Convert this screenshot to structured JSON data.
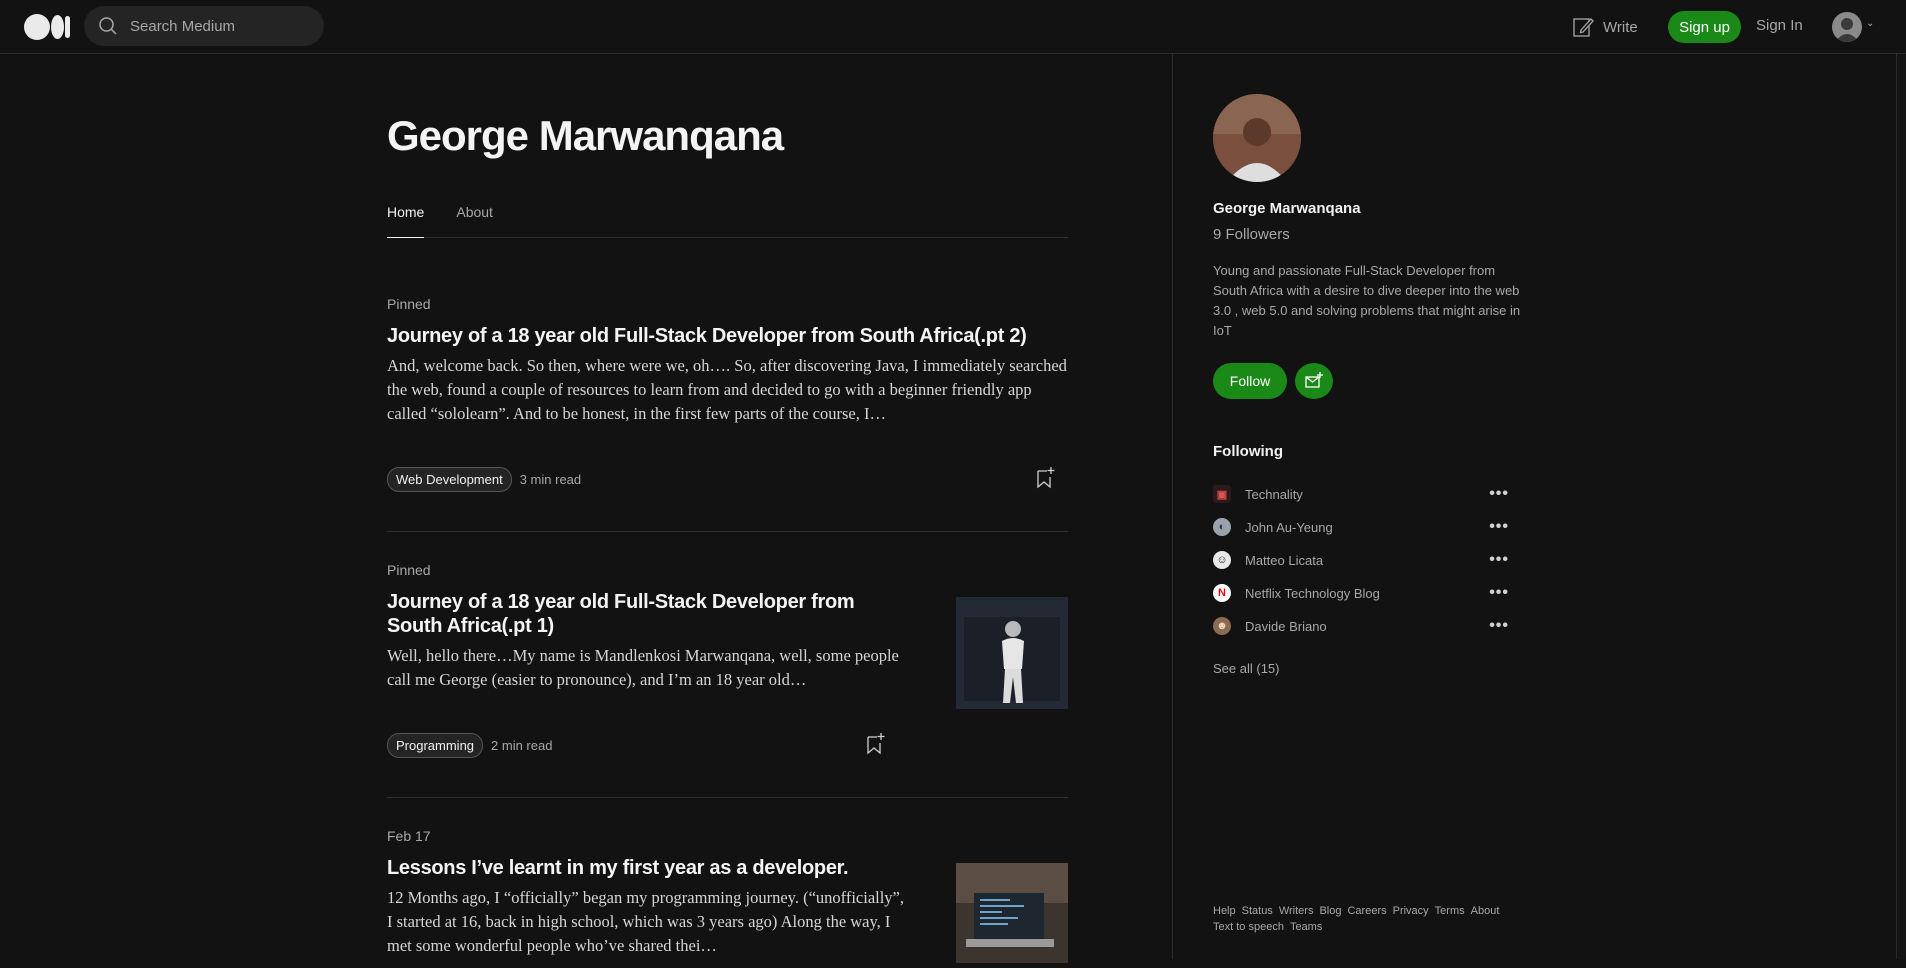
{
  "header": {
    "search_placeholder": "Search Medium",
    "write_label": "Write",
    "signup_label": "Sign up",
    "signin_label": "Sign In"
  },
  "profile": {
    "name": "George Marwanqana",
    "tabs": [
      {
        "label": "Home",
        "active": true
      },
      {
        "label": "About",
        "active": false
      }
    ]
  },
  "articles": [
    {
      "meta": "Pinned",
      "title": "Journey of a 18 year old Full-Stack Developer from South Africa(.pt 2)",
      "excerpt": "And, welcome back. So then, where were we, oh…. So, after discovering Java, I immediately searched the web, found a couple of resources to learn from and decided to go with a beginner friendly app called “sololearn”. And to be honest, in the first few parts of the course, I…",
      "tag": "Web Development",
      "read_time": "3 min read"
    },
    {
      "meta": "Pinned",
      "title": "Journey of a 18 year old Full-Stack Developer from South Africa(.pt 1)",
      "excerpt": "Well, hello there…My name is Mandlenkosi Marwanqana, well, some people call me George (easier to pronounce), and I’m an 18 year old…",
      "tag": "Programming",
      "read_time": "2 min read"
    },
    {
      "meta": "Feb 17",
      "title": "Lessons I’ve learnt in my first year as a developer.",
      "excerpt": "12 Months ago, I “officially” began my programming journey. (“unofficially”, I started at 16, back in high school, which was 3 years ago) Along the way, I met some wonderful people who’ve shared thei…"
    }
  ],
  "sidebar": {
    "name": "George Marwanqana",
    "followers": "9 Followers",
    "bio": "Young and passionate Full-Stack Developer from South Africa with a desire to dive deeper into the web 3.0 , web 5.0 and solving problems that might arise in IoT",
    "follow_label": "Follow",
    "following_heading": "Following",
    "following": [
      {
        "name": "Technality",
        "icon": "technality-logo"
      },
      {
        "name": "John Au-Yeung",
        "icon": "john-avatar"
      },
      {
        "name": "Matteo Licata",
        "icon": "matteo-avatar"
      },
      {
        "name": "Netflix Technology Blog",
        "icon": "netflix-logo"
      },
      {
        "name": "Davide Briano",
        "icon": "davide-avatar"
      }
    ],
    "more_label": "•••",
    "see_all": "See all (15)",
    "footer_links": [
      "Help",
      "Status",
      "Writers",
      "Blog",
      "Careers",
      "Privacy",
      "Terms",
      "About",
      "Text to speech",
      "Teams"
    ]
  },
  "colors": {
    "background": "#121212",
    "accent_green": "#1a8917",
    "text_muted": "#a8a8a8"
  }
}
